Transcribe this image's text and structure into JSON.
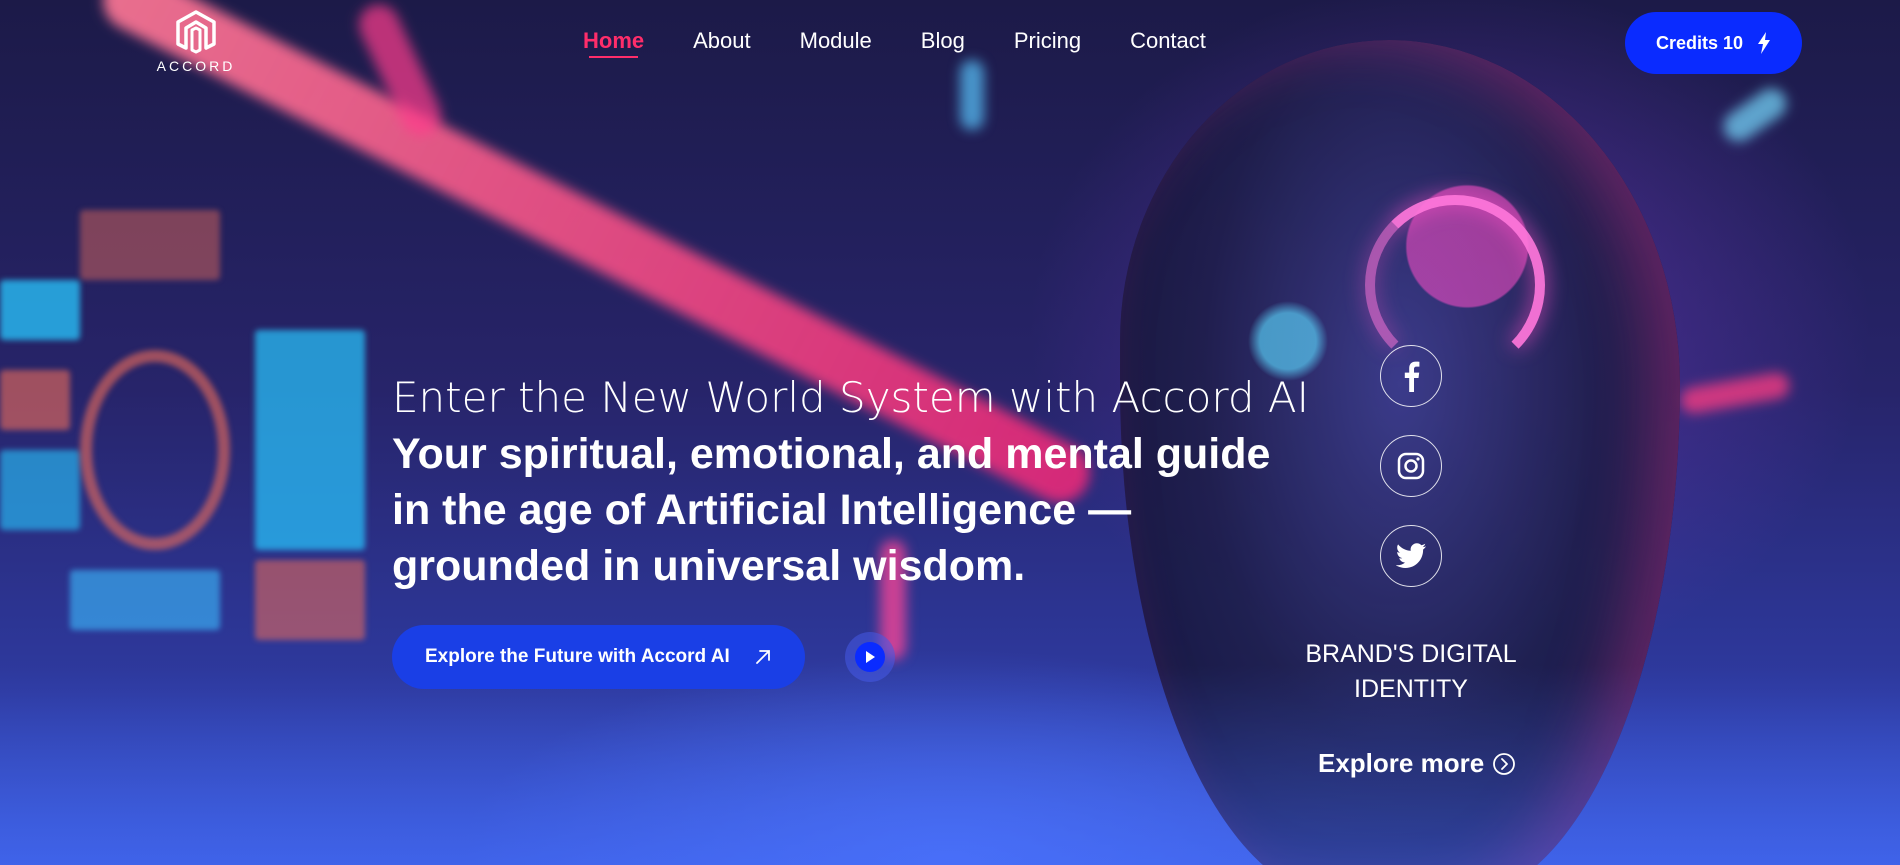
{
  "brand": {
    "logo_text": "ACCORD"
  },
  "nav": {
    "items": [
      {
        "label": "Home",
        "active": true
      },
      {
        "label": "About",
        "active": false
      },
      {
        "label": "Module",
        "active": false
      },
      {
        "label": "Blog",
        "active": false
      },
      {
        "label": "Pricing",
        "active": false
      },
      {
        "label": "Contact",
        "active": false
      }
    ],
    "credits_label": "Credits 10",
    "credits_icon": "lightning-icon"
  },
  "hero": {
    "subtitle": "Enter the New World System with Accord AI",
    "title_lines": [
      "Your spiritual, emotional, and mental guide",
      "in the age of Artificial Intelligence —",
      "grounded in universal wisdom."
    ],
    "cta_label": "Explore the Future with Accord AI",
    "cta_icon": "arrow-up-right-icon",
    "play_icon": "play-icon"
  },
  "side": {
    "social": [
      {
        "icon": "facebook-icon"
      },
      {
        "icon": "instagram-icon"
      },
      {
        "icon": "twitter-icon"
      }
    ],
    "brand_identity": "BRAND'S DIGITAL IDENTITY",
    "explore_label": "Explore more",
    "explore_icon": "chevron-right-circle-icon"
  },
  "colors": {
    "accent": "#ff2d6a",
    "primary_button": "#0a2bff",
    "cta_button": "#1a3fe6"
  }
}
